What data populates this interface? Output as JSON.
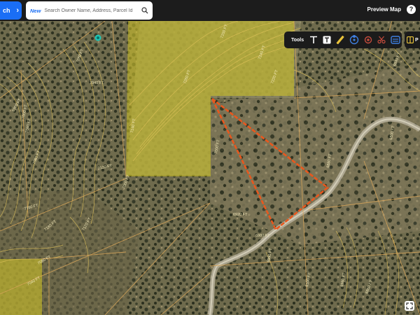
{
  "header": {
    "search_button_label": "ch",
    "new_badge": "New",
    "search_placeholder": "Search Owner Name, Address, Parcel Id",
    "preview_map_label": "Preview Map",
    "help_label": "?"
  },
  "tools": {
    "label": "Tools",
    "items": [
      "text-tool-icon",
      "text-box-icon",
      "ruler-icon",
      "draw-area-icon",
      "point-icon",
      "scissors-icon",
      "layers-icon"
    ]
  },
  "side_panel": {
    "label": "P"
  },
  "map": {
    "elevation_labels": [
      "7080 FT",
      "7040 FT",
      "6960 FT",
      "7000 FT",
      "7040 FT",
      "7080 FT",
      "7120 FT",
      "7140 FT",
      "7160 FT",
      "7180 FT",
      "7120 FT",
      "7080 FT",
      "7040 FT",
      "7200 FT",
      "7000 FT",
      "6980 FT",
      "6920 FT",
      "6960 FT",
      "6880 FT",
      "6840 FT",
      "6800 FT",
      "7240 FT",
      "7220 FT",
      "7260 FT",
      "7000 FT",
      "6980 FT",
      "6900 FT",
      "6860 FT"
    ],
    "colors": {
      "selection_outline": "#e8581e",
      "highlight_fill": "#c8bd2a",
      "parcel_lines": "#d9a65a"
    }
  }
}
